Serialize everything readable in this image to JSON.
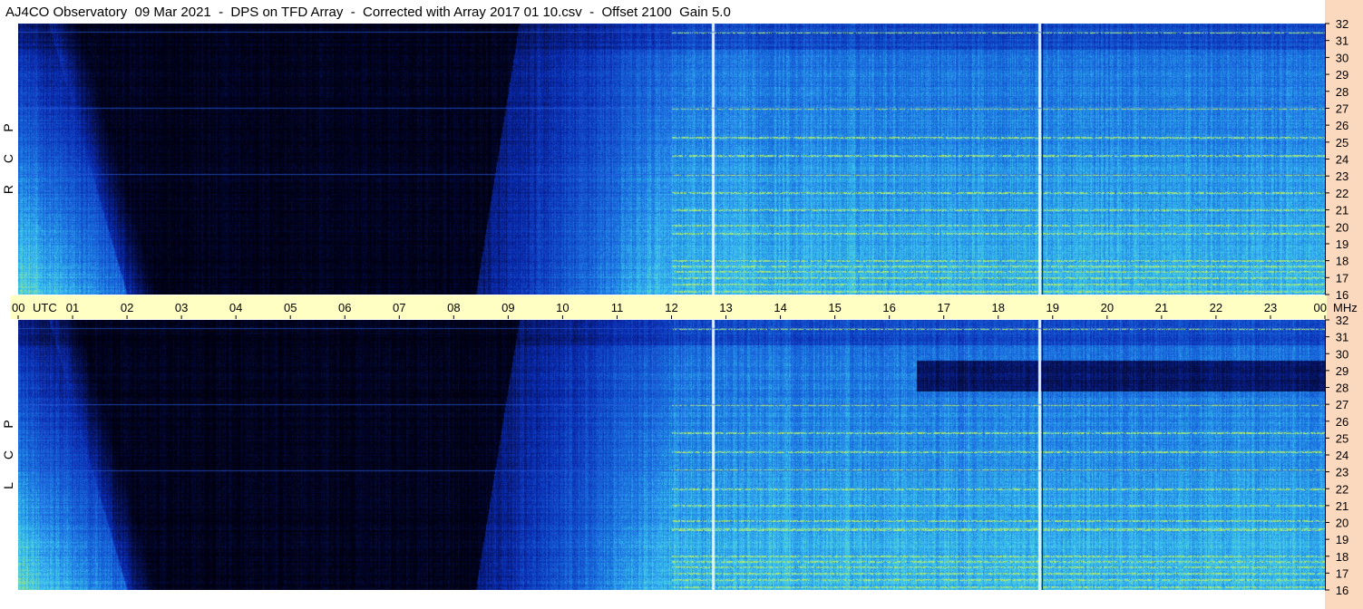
{
  "title": "AJ4CO Observatory  09 Mar 2021  -  DPS on TFD Array  -  Corrected with Array 2017 01 10.csv  -  Offset 2100  Gain 5.0",
  "chart_data": {
    "type": "heatmap",
    "x_unit_label": "UTC",
    "y_unit_label": "MHz",
    "x_ticks": [
      "00",
      "01",
      "02",
      "03",
      "04",
      "05",
      "06",
      "07",
      "08",
      "09",
      "10",
      "11",
      "12",
      "13",
      "14",
      "15",
      "16",
      "17",
      "18",
      "19",
      "20",
      "21",
      "22",
      "23",
      "00"
    ],
    "xlim": [
      0,
      24
    ],
    "y_ticks": [
      32,
      31,
      30,
      29,
      28,
      27,
      26,
      25,
      24,
      23,
      22,
      21,
      20,
      19,
      18,
      17,
      16
    ],
    "ylim": [
      16,
      32
    ],
    "panels": [
      {
        "label_letters": [
          "R",
          "C",
          "P"
        ]
      },
      {
        "label_letters": [
          "L",
          "C",
          "P"
        ]
      }
    ],
    "colors": {
      "background": "#000010",
      "deep_blue": "#0a2ab0",
      "mid_blue": "#1a6fe0",
      "cyan": "#3cc8f0",
      "yellow_green": "#c8f050",
      "utc_bar": "#ffffc4",
      "right_rail": "#fbd9bf"
    }
  }
}
